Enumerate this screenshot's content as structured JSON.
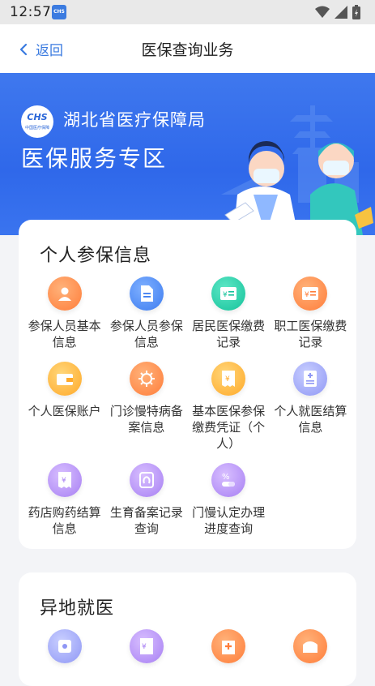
{
  "status_bar": {
    "time": "12:57",
    "app_badge": "CHS"
  },
  "nav": {
    "back_label": "返回",
    "title": "医保查询业务"
  },
  "banner": {
    "logo_text": "CHS",
    "logo_subtext": "中国医疗保障",
    "org_name": "湖北省医疗保障局",
    "zone_title": "医保服务专区"
  },
  "personal": {
    "title": "个人参保信息",
    "items": [
      {
        "label": "参保人员基本信息",
        "icon": "person-icon",
        "color": "#ff8a45"
      },
      {
        "label": "参保人员参保信息",
        "icon": "document-icon",
        "color": "#3d7cf0"
      },
      {
        "label": "居民医保缴费记录",
        "icon": "payment-record-icon",
        "color": "#14c29a"
      },
      {
        "label": "职工医保缴费记录",
        "icon": "payment-record-icon",
        "color": "#ff8a45"
      },
      {
        "label": "个人医保账户",
        "icon": "wallet-icon",
        "color": "#ffa928"
      },
      {
        "label": "门诊慢特病备案信息",
        "icon": "virus-icon",
        "color": "#ff8a45"
      },
      {
        "label": "基本医保参保缴费凭证（个人）",
        "icon": "receipt-icon",
        "color": "#ffa928"
      },
      {
        "label": "个人就医结算信息",
        "icon": "medical-record-icon",
        "color": "#8f97f5"
      },
      {
        "label": "药店购药结算信息",
        "icon": "pharmacy-receipt-icon",
        "color": "#a77ff3"
      },
      {
        "label": "生育备案记录查询",
        "icon": "baby-icon",
        "color": "#a77ff3"
      },
      {
        "label": "门慢认定办理进度查询",
        "icon": "pill-icon",
        "color": "#a77ff3"
      }
    ]
  },
  "remote": {
    "title": "异地就医",
    "items": [
      {
        "icon": "safe-icon",
        "color": "#8f97f5"
      },
      {
        "icon": "bill-icon",
        "color": "#a77ff3"
      },
      {
        "icon": "hospital-icon",
        "color": "#ff8a45"
      },
      {
        "icon": "building-icon",
        "color": "#ff8a45"
      }
    ]
  }
}
